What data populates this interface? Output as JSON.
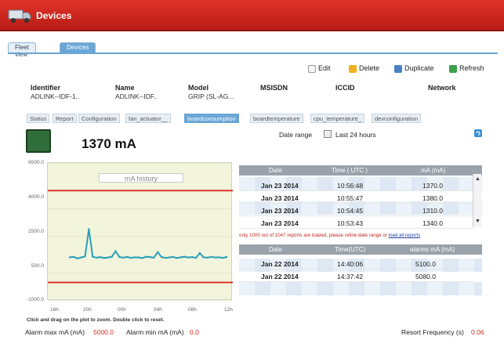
{
  "window": {
    "title": "Devices"
  },
  "view_tabs": [
    {
      "label": "Fleet view"
    },
    {
      "label": "Devices"
    }
  ],
  "actions": {
    "edit": "Edit",
    "delete": "Delete",
    "duplicate": "Duplicate",
    "refresh": "Refresh"
  },
  "device_header": {
    "columns": [
      "Identifier",
      "Name",
      "Model",
      "MSISDN",
      "ICCID",
      "Network"
    ],
    "values": [
      "ADLINK--IDF-1..",
      "ADLINK--IDF..",
      "GRIP (SL-AG...",
      "",
      "",
      ""
    ]
  },
  "detail_tabs": [
    {
      "label": "Status"
    },
    {
      "label": "Report"
    },
    {
      "label": "Configuration"
    },
    {
      "label": "fan_actuator__"
    },
    {
      "label": "boardconsumption"
    },
    {
      "label": "boardtemperature"
    },
    {
      "label": "cpu_temperature_"
    },
    {
      "label": "devconfiguration"
    }
  ],
  "current": {
    "value": "1370 mA"
  },
  "date_range": {
    "label": "Date range",
    "value": "Last 24 hours"
  },
  "chart_data": {
    "type": "line",
    "title": "mA history",
    "xlabel": "",
    "ylabel": "",
    "ylim": [
      -1000,
      6500
    ],
    "yticks": [
      "6500.0",
      "4000.0",
      "2500.0",
      "500.0",
      "-1000.0"
    ],
    "xticks": [
      "16h",
      "20h",
      "00h",
      "04h",
      "08h",
      "12h"
    ],
    "threshold_max": 5000,
    "threshold_min": 0,
    "series": [
      {
        "values": [
          1370,
          1390,
          1310,
          1360,
          1420,
          2900,
          1400,
          1350,
          1380,
          1330,
          1360,
          1400,
          1700,
          1380,
          1350,
          1390,
          1340,
          1370,
          1360,
          1330,
          1400,
          1380,
          1350,
          1650,
          1380,
          1340,
          1360,
          1390,
          1330,
          1370,
          1400,
          1360,
          1380,
          1340,
          1600,
          1370,
          1350,
          1390,
          1360,
          1370,
          1340,
          1380
        ]
      }
    ],
    "colors": {
      "line": "#2a9fb8",
      "threshold": "#e0322a"
    }
  },
  "chart_hint": "Click and drag on the plot to zoom. Double click to reset.",
  "reports_table": {
    "headers": [
      "Date",
      "Time ( UTC )",
      "mA (mA)"
    ],
    "rows": [
      [
        "Jan 23 2014",
        "10:56:48",
        "1370.0"
      ],
      [
        "Jan 23 2014",
        "10:55:47",
        "1380.0"
      ],
      [
        "Jan 23 2014",
        "10:54:45",
        "1310.0"
      ],
      [
        "Jan 23 2014",
        "10:53:43",
        "1340.0"
      ]
    ]
  },
  "notice": {
    "text": "only 1000 out of 1047 reports are loaded, please refine date range or ",
    "link": "load all reports"
  },
  "alarms_table": {
    "headers": [
      "Date",
      "Time(UTC)",
      "alarms mA (mA)"
    ],
    "rows": [
      [
        "Jan 22 2014",
        "14:40:06",
        "5100.0"
      ],
      [
        "Jan 22 2014",
        "14:37:42",
        "5080.0"
      ]
    ]
  },
  "footer": {
    "alarm_max_label": "Alarm max mA (mA)",
    "alarm_max_value": "5000.0",
    "alarm_min_label": "Alarm min mA (mA)",
    "alarm_min_value": "0.0",
    "report_freq_label": "Resort Frequency (s)",
    "report_freq_value": "0.06"
  }
}
